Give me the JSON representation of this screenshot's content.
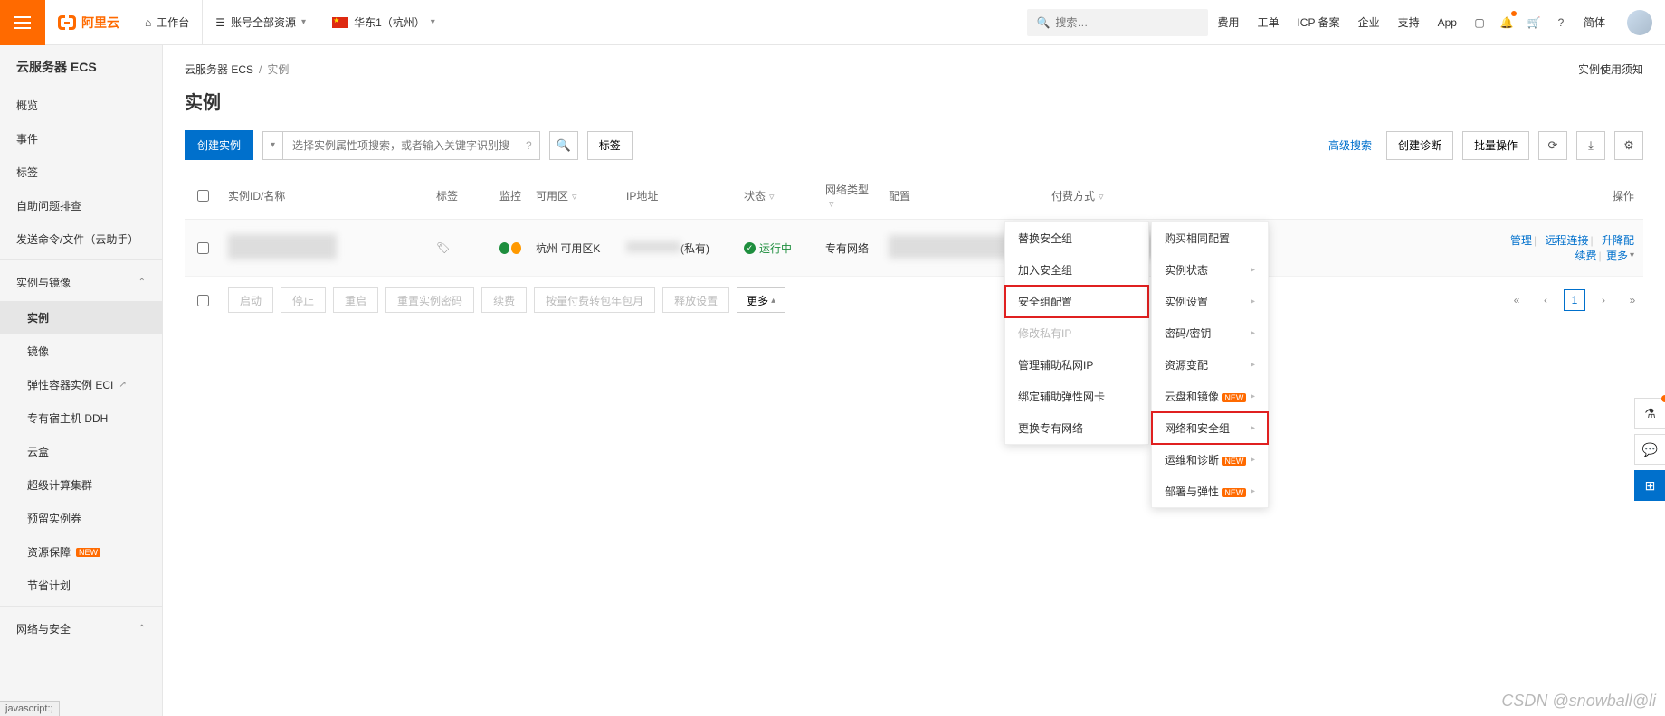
{
  "topbar": {
    "brand": "阿里云",
    "workspace": "工作台",
    "resource_scope": "账号全部资源",
    "region": "华东1（杭州）",
    "search_placeholder": "搜索…",
    "links": [
      "费用",
      "工单",
      "ICP 备案",
      "企业",
      "支持",
      "App"
    ],
    "lang": "简体"
  },
  "sidebar": {
    "product": "云服务器 ECS",
    "items_top": [
      "概览",
      "事件",
      "标签",
      "自助问题排查",
      "发送命令/文件（云助手）"
    ],
    "group_instance": "实例与镜像",
    "items_instance": [
      {
        "label": "实例",
        "active": true
      },
      {
        "label": "镜像"
      },
      {
        "label": "弹性容器实例 ECI",
        "ext": true
      },
      {
        "label": "专有宿主机 DDH"
      },
      {
        "label": "云盒"
      },
      {
        "label": "超级计算集群"
      },
      {
        "label": "预留实例券"
      },
      {
        "label": "资源保障",
        "new": true
      },
      {
        "label": "节省计划"
      }
    ],
    "group_network": "网络与安全"
  },
  "breadcrumb": {
    "root": "云服务器 ECS",
    "current": "实例"
  },
  "usage_notice": "实例使用须知",
  "page_title": "实例",
  "toolbar": {
    "create": "创建实例",
    "search_placeholder": "选择实例属性项搜索，或者输入关键字识别搜索",
    "tag_btn": "标签",
    "adv_search": "高级搜索",
    "create_diag": "创建诊断",
    "bulk_ops": "批量操作"
  },
  "columns": {
    "id": "实例ID/名称",
    "tag": "标签",
    "monitor": "监控",
    "zone": "可用区",
    "ip": "IP地址",
    "status": "状态",
    "nettype": "网络类型",
    "config": "配置",
    "paytype": "付费方式",
    "ops": "操作"
  },
  "row": {
    "zone": "杭州 可用区K",
    "ip_suffix": "(私有)",
    "status": "运行中",
    "nettype": "专有网络",
    "ops": {
      "manage": "管理",
      "remote": "远程连接",
      "upgrade": "升降配",
      "renew": "续费",
      "more": "更多"
    }
  },
  "bulk": {
    "buttons": [
      "启动",
      "停止",
      "重启",
      "重置实例密码",
      "续费",
      "按量付费转包年包月",
      "释放设置"
    ],
    "more": "更多"
  },
  "pager": {
    "current": "1"
  },
  "dropdown_main": [
    {
      "label": "购买相同配置"
    },
    {
      "label": "实例状态",
      "sub": true
    },
    {
      "label": "实例设置",
      "sub": true
    },
    {
      "label": "密码/密钥",
      "sub": true
    },
    {
      "label": "资源变配",
      "sub": true
    },
    {
      "label": "云盘和镜像",
      "sub": true,
      "new": true
    },
    {
      "label": "网络和安全组",
      "sub": true,
      "highlight": true
    },
    {
      "label": "运维和诊断",
      "sub": true,
      "new": true
    },
    {
      "label": "部署与弹性",
      "sub": true,
      "new": true
    }
  ],
  "dropdown_sub": [
    {
      "label": "替换安全组"
    },
    {
      "label": "加入安全组"
    },
    {
      "label": "安全组配置",
      "highlight": true
    },
    {
      "label": "修改私有IP",
      "disabled": true
    },
    {
      "label": "管理辅助私网IP"
    },
    {
      "label": "绑定辅助弹性网卡"
    },
    {
      "label": "更换专有网络"
    }
  ],
  "footer_status": "javascript:;",
  "watermark": "CSDN @snowball@li"
}
